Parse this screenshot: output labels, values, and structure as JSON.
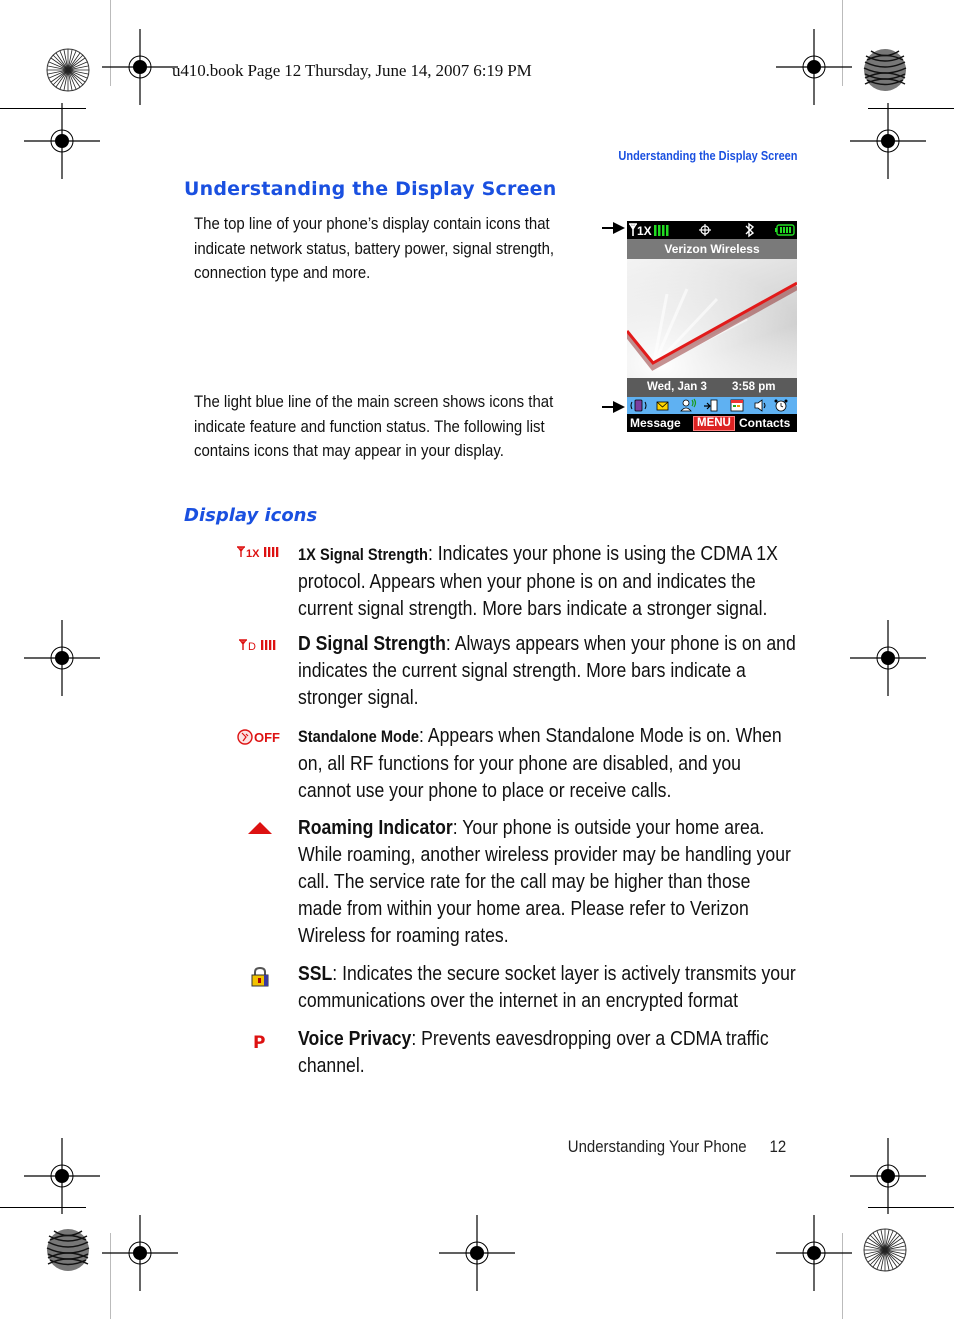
{
  "slug": "u410.book  Page 12  Thursday, June 14, 2007  6:19 PM",
  "running_head": "Understanding the Display Screen",
  "heading": "Understanding the Display Screen",
  "intro": {
    "top_line": "The top line of your phone’s display contain icons that indicate network status, battery power, signal strength, connection type and more.",
    "blue_line": "The light blue line of the main screen shows icons that indicate feature and function status. The following list contains icons that may appear in your display."
  },
  "phone_screen": {
    "network": "1X",
    "carrier": "Verizon Wireless",
    "date": "Wed, Jan 3",
    "time": "3:58 pm",
    "softkeys": {
      "left": "Message",
      "center": "MENU",
      "right": "Contacts"
    },
    "status_icons": [
      "antenna-icon",
      "signal-bars-icon",
      "location-icon",
      "bluetooth-icon",
      "battery-icon"
    ],
    "feature_icons": [
      "vibrate-icon",
      "message-envelope-icon",
      "voice-command-icon",
      "call-forward-icon",
      "calendar-icon",
      "speaker-icon",
      "alarm-clock-icon"
    ],
    "accent_status_green": "#22dd22",
    "icon_bar_color": "#5fb1f2"
  },
  "subheading": "Display icons",
  "display_icons": [
    {
      "icon": "1x-signal-strength-icon",
      "name": "1X Signal Strength",
      "description": ": Indicates your phone is using the CDMA 1X protocol. Appears when your phone is on and indicates the current signal strength. More bars indicate a stronger signal."
    },
    {
      "icon": "d-signal-strength-icon",
      "name": "D Signal Strength",
      "description": ": Always appears when your phone is on and indicates the current signal strength. More bars indicate a stronger signal."
    },
    {
      "icon": "standalone-off-icon",
      "name": "Standalone Mode",
      "description": ": Appears when Standalone Mode is on. When on, all RF functions for your phone are disabled, and you cannot use your phone to place or receive calls."
    },
    {
      "icon": "roaming-triangle-icon",
      "name": "Roaming Indicator",
      "description": ": Your phone is outside your home area. While roaming, another wireless provider may be handling your call. The service rate for the call may be higher than those made from within your home area. Please refer to Verizon Wireless for roaming rates."
    },
    {
      "icon": "ssl-lock-icon",
      "name": "SSL",
      "description": ": Indicates the secure socket layer is actively transmits your communications over the internet in an encrypted format"
    },
    {
      "icon": "voice-privacy-icon",
      "name": "Voice Privacy",
      "description": ": Prevents eavesdropping over a CDMA traffic channel."
    }
  ],
  "footer": {
    "section": "Understanding Your Phone",
    "page": "12"
  },
  "colors": {
    "heading_blue": "#1a50e0",
    "icon_red": "#dd1111"
  }
}
